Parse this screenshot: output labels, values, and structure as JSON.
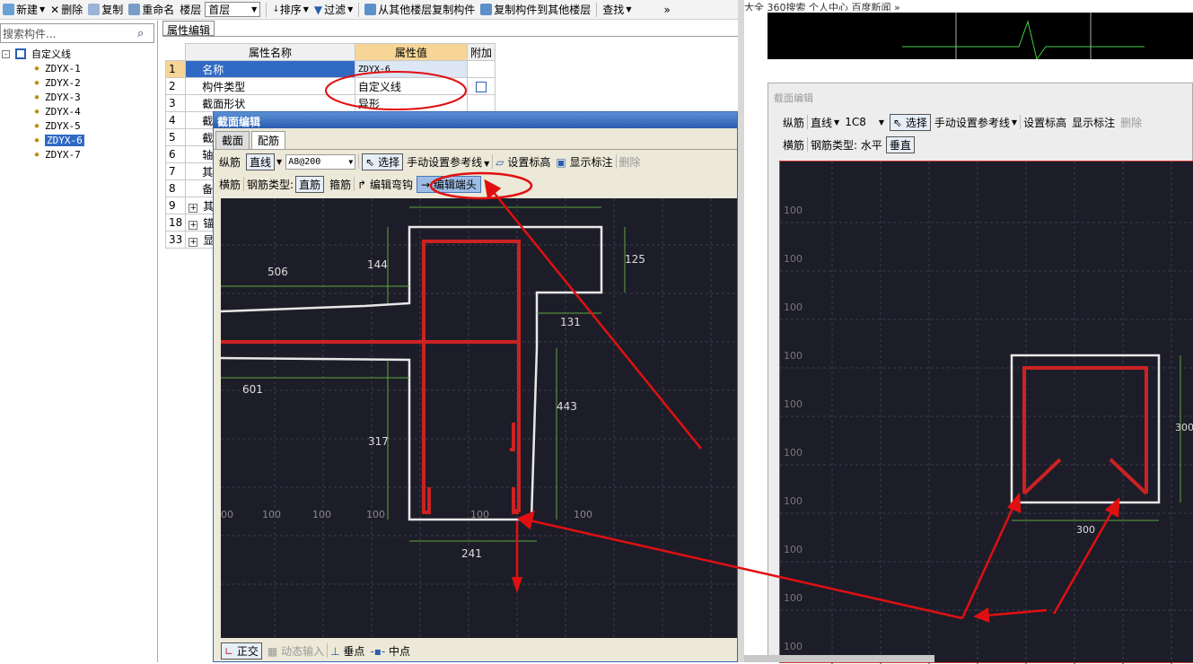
{
  "toolbar": {
    "new_label": "新建",
    "delete_label": "删除",
    "copy_label": "复制",
    "rename_label": "重命名",
    "floor_label": "楼层",
    "floor_value": "首层",
    "sort_label": "排序",
    "filter_label": "过滤",
    "copy_from_other_floor": "从其他楼层复制构件",
    "copy_to_other_floor": "复制构件到其他楼层",
    "find_label": "查找",
    "more": "»"
  },
  "search": {
    "placeholder": "搜索构件..."
  },
  "tree": {
    "root": "自定义线",
    "items": [
      "ZDYX-1",
      "ZDYX-2",
      "ZDYX-3",
      "ZDYX-4",
      "ZDYX-5",
      "ZDYX-6",
      "ZDYX-7"
    ],
    "selected": "ZDYX-6"
  },
  "properties": {
    "tab": "属性编辑",
    "headers": [
      "属性名称",
      "属性值",
      "附加"
    ],
    "rows": [
      {
        "no": "1",
        "name": "名称",
        "value": "ZDYX-6"
      },
      {
        "no": "2",
        "name": "构件类型",
        "value": "自定义线"
      },
      {
        "no": "3",
        "name": "截面形状",
        "value": "异形"
      },
      {
        "no": "4",
        "name": "截"
      },
      {
        "no": "5",
        "name": "截"
      },
      {
        "no": "6",
        "name": "轴"
      },
      {
        "no": "7",
        "name": "其"
      },
      {
        "no": "8",
        "name": "备"
      },
      {
        "no": "9",
        "name": "其",
        "expand": "+"
      },
      {
        "no": "18",
        "name": "锚",
        "expand": "+"
      },
      {
        "no": "33",
        "name": "显",
        "expand": "+"
      }
    ]
  },
  "dialog": {
    "title": "截面编辑",
    "tabs": [
      "截面",
      "配筋"
    ],
    "active_tab": "配筋",
    "row1": {
      "long_rebar": "纵筋",
      "line_mode": "直线",
      "rebar_spec": "A8@200",
      "select": "选择",
      "manual_ref_line": "手动设置参考线",
      "set_elevation": "设置标高",
      "show_labels": "显示标注",
      "delete": "删除"
    },
    "row2": {
      "transverse": "横筋",
      "rebar_type_label": "钢筋类型:",
      "rebar_type_value": "直筋",
      "stirrup": "箍筋",
      "edit_hook": "编辑弯钩",
      "edit_end": "编辑端头"
    },
    "dimensions": {
      "d506": "506",
      "d144": "144",
      "d125": "125",
      "d131": "131",
      "d601": "601",
      "d443": "443",
      "d317": "317",
      "d241": "241"
    },
    "grid_labels": [
      "00",
      "100",
      "100",
      "100",
      "100",
      "100"
    ],
    "status": {
      "ortho": "正交",
      "dynamic_input": "动态输入",
      "perpendicular": "垂点",
      "midpoint": "中点"
    }
  },
  "right_panel": {
    "top_strip": "大全   360搜索   个人中心   百度新闻   »",
    "dialog_title": "截面编辑",
    "row1": {
      "long_rebar": "纵筋",
      "line_mode": "直线",
      "rebar_spec": "1C8",
      "select": "选择",
      "manual_ref_line": "手动设置参考线",
      "set_elevation": "设置标高",
      "show_labels": "显示标注",
      "delete": "删除"
    },
    "row2": {
      "transverse": "横筋",
      "rebar_type_label": "钢筋类型: 水平",
      "vertical": "垂直"
    },
    "grid_labels": [
      "100",
      "100",
      "100",
      "100",
      "100",
      "100",
      "100",
      "100",
      "100",
      "100"
    ],
    "dim_300_bottom": "300",
    "dim_300_side": "300"
  },
  "colors": {
    "canvas_bg": "#1d1d29",
    "rebar_red": "#cc2222",
    "annotation_red": "#e01010",
    "dim_green": "#5fa83a",
    "selection_blue": "#316ac5"
  }
}
